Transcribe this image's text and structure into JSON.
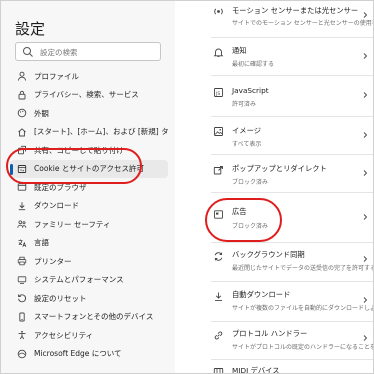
{
  "sidebar": {
    "title": "設定",
    "search_placeholder": "設定の検索",
    "items": [
      {
        "label": "プロファイル",
        "icon": "person-icon"
      },
      {
        "label": "プライバシー、検索、サービス",
        "icon": "lock-icon"
      },
      {
        "label": "外観",
        "icon": "appearance-icon"
      },
      {
        "label": "[スタート]、[ホーム]、および [新規] タブ",
        "icon": "home-icon"
      },
      {
        "label": "共有、コピーして貼り付け",
        "icon": "share-icon"
      },
      {
        "label": "Cookie とサイトのアクセス許可",
        "icon": "cookie-icon"
      },
      {
        "label": "既定のブラウザ",
        "icon": "browser-icon"
      },
      {
        "label": "ダウンロード",
        "icon": "download-icon"
      },
      {
        "label": "ファミリー セーフティ",
        "icon": "family-icon"
      },
      {
        "label": "言語",
        "icon": "language-icon"
      },
      {
        "label": "プリンター",
        "icon": "printer-icon"
      },
      {
        "label": "システムとパフォーマンス",
        "icon": "system-icon"
      },
      {
        "label": "設定のリセット",
        "icon": "reset-icon"
      },
      {
        "label": "スマートフォンとその他のデバイス",
        "icon": "phone-icon"
      },
      {
        "label": "アクセシビリティ",
        "icon": "accessibility-icon"
      },
      {
        "label": "Microsoft Edge について",
        "icon": "edge-icon"
      }
    ],
    "active_index": 5
  },
  "permissions": [
    {
      "title": "モーション センサーまたは光センサー",
      "subtitle": "サイトでのモーション センサーと光センサーの使用を許可する",
      "icon": "sensor-icon"
    },
    {
      "title": "通知",
      "subtitle": "最初に確認する",
      "icon": "bell-icon"
    },
    {
      "title": "JavaScript",
      "subtitle": "許可済み",
      "icon": "javascript-icon"
    },
    {
      "title": "イメージ",
      "subtitle": "すべて表示",
      "icon": "image-icon"
    },
    {
      "title": "ポップアップとリダイレクト",
      "subtitle": "ブロック済み",
      "icon": "popup-icon"
    },
    {
      "title": "広告",
      "subtitle": "ブロック済み",
      "icon": "ads-icon"
    },
    {
      "title": "バックグラウンド同期",
      "subtitle": "最近閉じたサイトでデータの送受信の完了を許可する",
      "icon": "sync-icon"
    },
    {
      "title": "自動ダウンロード",
      "subtitle": "サイトが複数のファイルを自動的にダウンロードしようとしたときに確認する",
      "icon": "auto-download-icon"
    },
    {
      "title": "プロトコル ハンドラー",
      "subtitle": "サイトがプロトコルの既定のハンドラーになることを許可する",
      "icon": "protocol-icon"
    },
    {
      "title": "MIDI デバイス",
      "subtitle": "",
      "icon": "midi-icon"
    }
  ],
  "colors": {
    "accent": "#0a5fb4",
    "highlight_circle": "#e01d1d"
  }
}
